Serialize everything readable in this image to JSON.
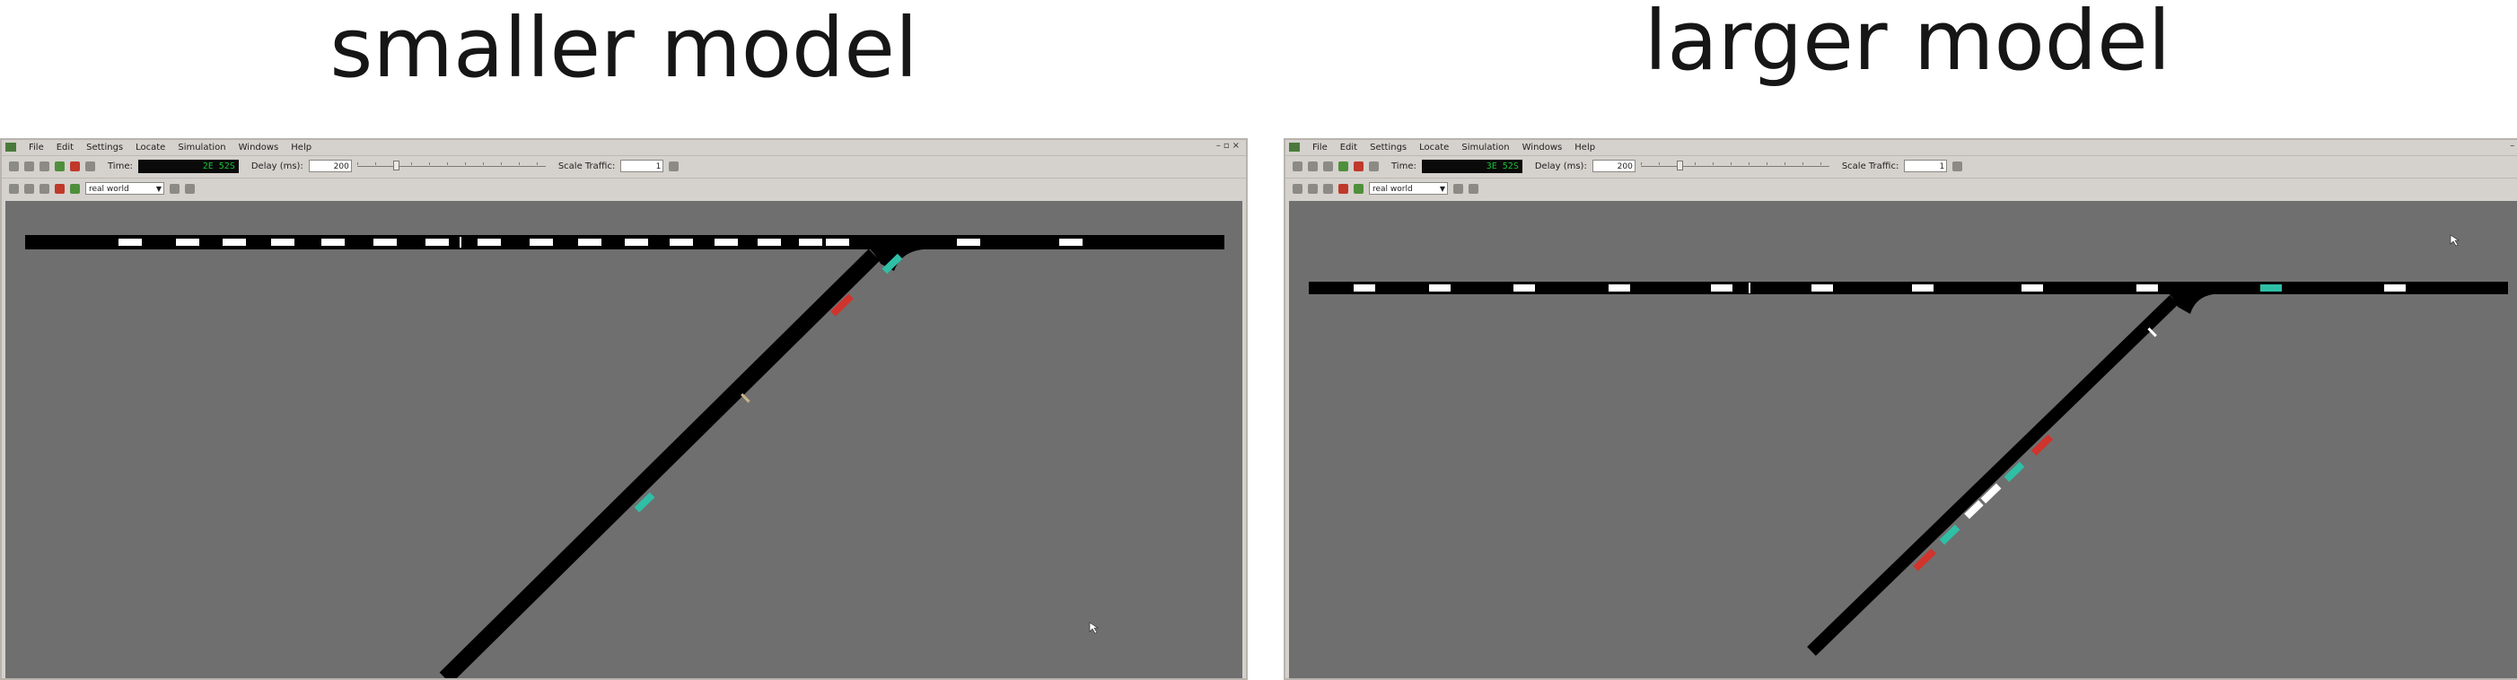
{
  "panels": [
    {
      "caption": "smaller model",
      "menu": [
        "File",
        "Edit",
        "Settings",
        "Locate",
        "Simulation",
        "Windows",
        "Help"
      ],
      "time_label": "Time:",
      "time_value": "2E 52S",
      "delay_label": "Delay (ms):",
      "delay_value": "200",
      "scale_label": "Scale Traffic:",
      "scale_value": "1",
      "view_scheme": "real world",
      "icons": [
        "open-icon",
        "reload-icon",
        "save-icon",
        "run-icon",
        "stop-icon",
        "step-icon",
        "locate-icon",
        "zoom-icon",
        "settings-icon"
      ]
    },
    {
      "caption": "larger model",
      "menu": [
        "File",
        "Edit",
        "Settings",
        "Locate",
        "Simulation",
        "Windows",
        "Help"
      ],
      "time_label": "Time:",
      "time_value": "3E 52S",
      "delay_label": "Delay (ms):",
      "delay_value": "200",
      "scale_label": "Scale Traffic:",
      "scale_value": "1",
      "view_scheme": "real world",
      "icons": [
        "open-icon",
        "reload-icon",
        "save-icon",
        "run-icon",
        "stop-icon",
        "step-icon",
        "locate-icon",
        "zoom-icon",
        "settings-icon"
      ]
    }
  ],
  "colors": {
    "canvas_background": "#6f6f6f",
    "road": "#000000",
    "vehicle_default": "#ffffff",
    "vehicle_red": "#d0342c",
    "vehicle_teal": "#2fbfa6",
    "lcd_text": "#18c23a"
  }
}
